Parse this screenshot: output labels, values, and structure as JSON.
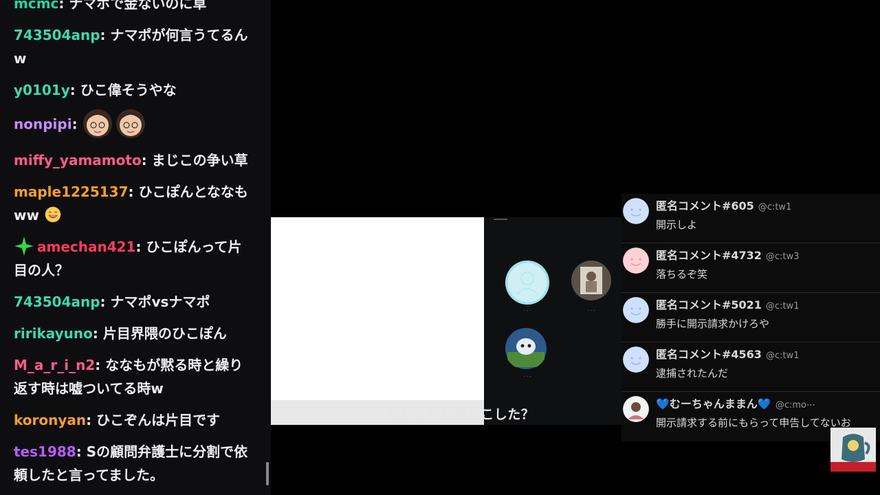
{
  "chat": {
    "messages": [
      {
        "user": "mcmc",
        "color": "#29d3a4",
        "text": "ナマポで金ないのに草"
      },
      {
        "user": "743504anp",
        "color": "#3ed8b1",
        "text": "ナマポが何言うてるんw"
      },
      {
        "user": "y0101y",
        "color": "#3ed8b1",
        "text": "ひこ偉そうやな"
      },
      {
        "user": "nonpipi",
        "color": "#c88cff",
        "text": ""
      },
      {
        "user": "miffy_yamamoto",
        "color": "#ff5c8a",
        "text": "まじこの争い草"
      },
      {
        "user": "maple1225137",
        "color": "#f79e2f",
        "text": "ひこぽんとななもww"
      },
      {
        "user": "amechan421",
        "color": "#ff3b5c",
        "text": "ひこぽんって片目の人？"
      },
      {
        "user": "743504anp",
        "color": "#3ed8b1",
        "text": "ナマポvsナマポ"
      },
      {
        "user": "ririkayuno",
        "color": "#3ed8b1",
        "text": "片目界隈のひこぽん"
      },
      {
        "user": "M_a_r_i_n2",
        "color": "#ff5c8a",
        "text": "ななもが黙る時と繰り返す時は嘘ついてる時w"
      },
      {
        "user": "koronyan",
        "color": "#f79e2f",
        "text": "ひこぞんは片目です"
      },
      {
        "user": "tes1988",
        "color": "#b85cff",
        "text": "Sの顧問弁護士に分割で依頼したと言ってました。"
      }
    ]
  },
  "video": {
    "subtitle": "ななもが犯罪起こした？"
  },
  "comments": [
    {
      "name": "匿名コメント#605",
      "handle": "@c:tw1",
      "text": "開示しよ",
      "avatar_color": "#cfe0ff"
    },
    {
      "name": "匿名コメント#4732",
      "handle": "@c:tw3",
      "text": "落ちるぞ笑",
      "avatar_color": "#ffd1d6"
    },
    {
      "name": "匿名コメント#5021",
      "handle": "@c:tw1",
      "text": "勝手に開示請求かけろや",
      "avatar_color": "#cfe0ff"
    },
    {
      "name": "匿名コメント#4563",
      "handle": "@c:tw1",
      "text": "逮捕されたんだ",
      "avatar_color": "#cfe0ff"
    },
    {
      "name": "💙むーちゃんままん💙",
      "handle": "@c:mo⋯",
      "text": "開示請求する前にもらって申告してないお",
      "avatar_color": "#f2f2f2"
    }
  ]
}
